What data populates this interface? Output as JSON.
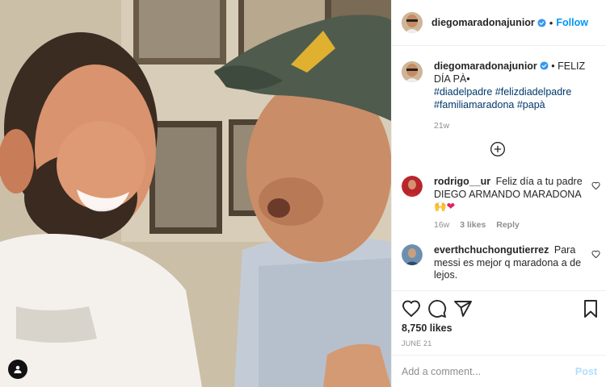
{
  "post": {
    "username": "diegomaradonajunior",
    "follow_label": "Follow",
    "dot": "•"
  },
  "caption": {
    "username": "diegomaradonajunior",
    "text": "• FELIZ DÍA PÀ•",
    "hashtags": [
      "#diadelpadre",
      "#felizdiadelpadre",
      "#familiamaradona",
      "#papà"
    ],
    "time": "21w"
  },
  "comments": [
    {
      "username": "rodrigo__ur",
      "text_line1": "Feliz día a tu padre DIEGO ARMANDO MARADONA",
      "emojis": "🙌❤",
      "time": "16w",
      "likes": "3 likes",
      "reply": "Reply"
    },
    {
      "username": "everthchuchongutierrez",
      "text": "Para messi es mejor q maradona a de lejos."
    }
  ],
  "stats": {
    "likes": "8,750 likes",
    "date": "JUNE 21"
  },
  "add_comment": {
    "placeholder": "Add a comment...",
    "post_label": "Post"
  },
  "colors": {
    "accent": "#0095f6",
    "link": "#00376b",
    "muted": "#8e8e8e",
    "post_disabled": "#b2dffc",
    "verified": "#3897f0"
  },
  "icons": [
    "tag-icon",
    "verified-icon",
    "add-comment-circle-icon",
    "heart-icon",
    "comment-icon",
    "share-icon",
    "bookmark-icon"
  ]
}
